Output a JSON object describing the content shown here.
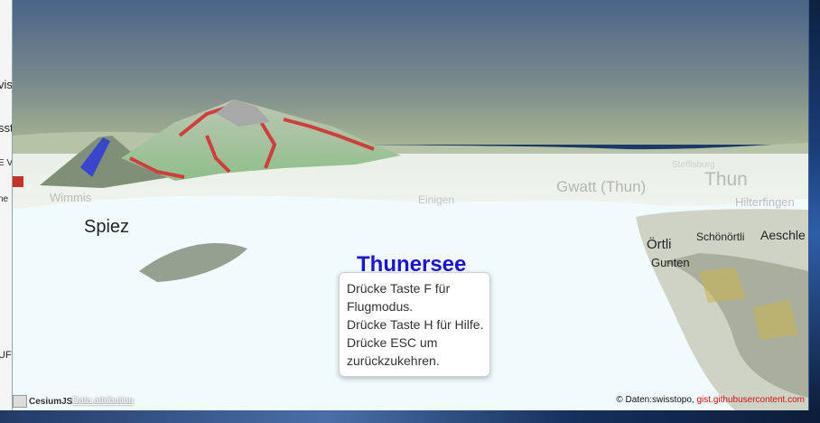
{
  "background_page": {
    "fragments": [
      "vis",
      "sst",
      "E V",
      "ne",
      "UF"
    ]
  },
  "map": {
    "labels": {
      "spiez": "Spiez",
      "wimmis": "Wimmis",
      "einigen": "Einigen",
      "gwatt": "Gwatt (Thun)",
      "thun": "Thun",
      "hilterfingen": "Hilterfingen",
      "aeschle": "Aeschle",
      "schoenoertli": "Schönörtli",
      "oertli": "Örtli",
      "gunten": "Gunten",
      "steffisburg": "Steffisburg",
      "thunersee": "Thunersee"
    },
    "lake_label_color": "#1a12e0"
  },
  "help": {
    "lines": [
      "Drücke Taste F für Flugmodus.",
      "Drücke Taste H für Hilfe.",
      "Drücke ESC um zurückzukehren."
    ]
  },
  "footer": {
    "logo_text": "CesiumJS",
    "data_attribution": "Data attribution",
    "credits_prefix": "© Daten:swisstopo, ",
    "credits_link": "gist.githubusercontent.com"
  }
}
